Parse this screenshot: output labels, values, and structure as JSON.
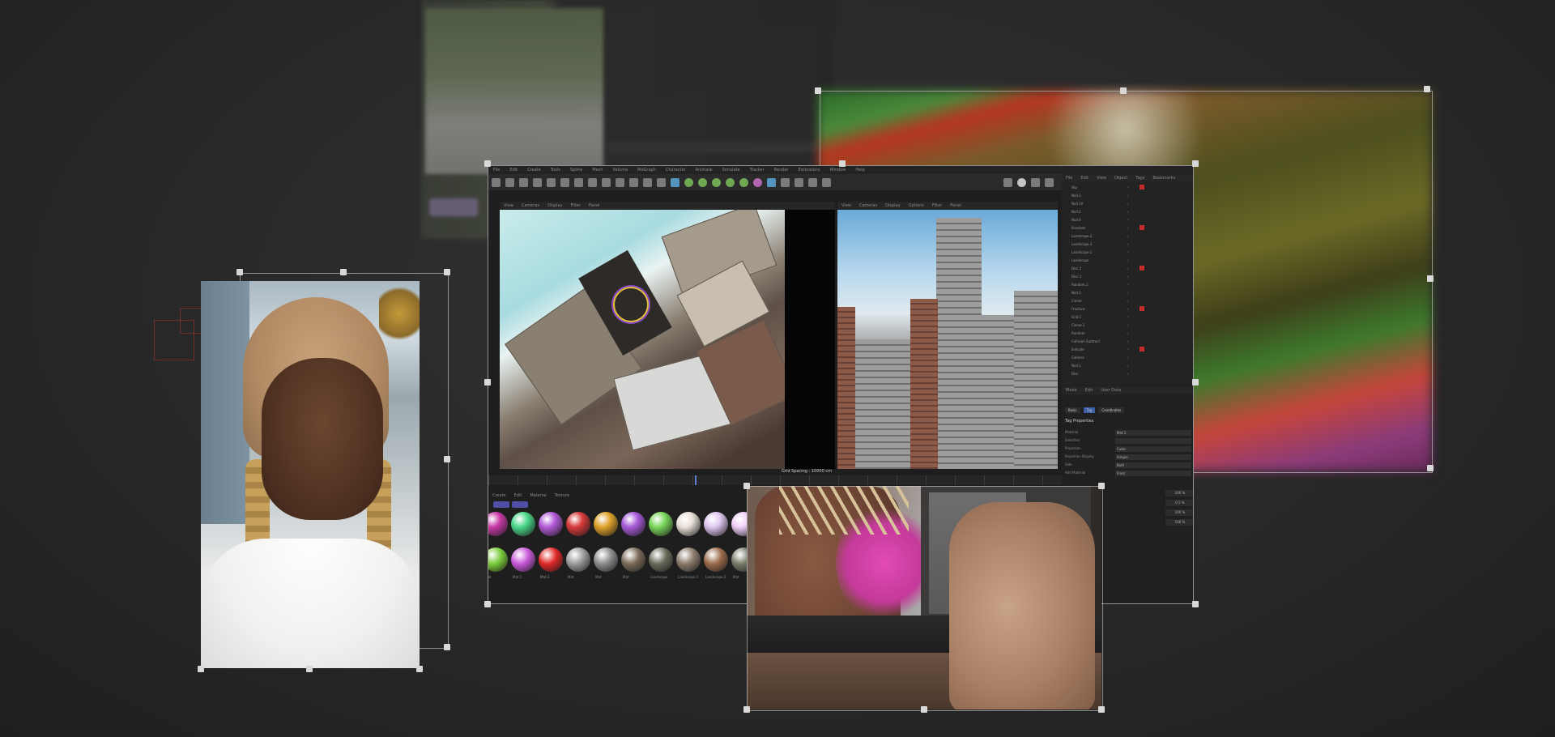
{
  "app": {
    "menu": [
      "File",
      "Edit",
      "Create",
      "Tools",
      "Spline",
      "Mesh",
      "Volume",
      "MoGraph",
      "Character",
      "Animate",
      "Simulate",
      "Tracker",
      "Render",
      "Extensions",
      "Window",
      "Help"
    ],
    "viewport_left_menu": [
      "View",
      "Cameras",
      "Display",
      "Filter",
      "Panel"
    ],
    "viewport_right_menu": [
      "View",
      "Cameras",
      "Display",
      "Options",
      "Filter",
      "Panel"
    ],
    "grid_spacing": "Grid Spacing : 10000 cm",
    "object_manager_menu": [
      "File",
      "Edit",
      "View",
      "Object",
      "Tags",
      "Bookmarks"
    ],
    "objects": [
      "Sky",
      "Null.3",
      "Null.10",
      "Null.2",
      "Null.6",
      "Brackets",
      "Landscape.2",
      "Landscape.3",
      "Landscape.1",
      "Landscape",
      "Disc.2",
      "Disc.1",
      "Random.1",
      "Null.3",
      "Cloner",
      "Fracture",
      "Grid.1",
      "Cloner.1",
      "Random",
      "Collision Subtract",
      "Extrude",
      "Camera",
      "Null.1",
      "Disc"
    ],
    "attributes_menu": [
      "Mode",
      "Edit",
      "User Data"
    ],
    "attributes_tabs": [
      "Basic",
      "Tag",
      "Coordinates"
    ],
    "attributes_title": "Tag Properties",
    "attributes_rows": [
      "Material",
      "Selection",
      "Projection",
      "Projection Display",
      "Side",
      "Add Material"
    ],
    "attributes_values": [
      "Mat.1",
      "",
      "Cubic",
      "Simple",
      "Both",
      "Front"
    ],
    "percent_values": [
      "100 %",
      "0.5 %",
      "100 %",
      "100 %"
    ],
    "materials_menu": [
      "Create",
      "Edit",
      "Material",
      "Texture"
    ],
    "materials_row2_labels": [
      "Mat",
      "Mat.1",
      "Mat.2",
      "Mat",
      "Mat",
      "Mat",
      "Landscape",
      "Landscape.1",
      "Landscape.2",
      "Mat",
      "Mat"
    ]
  },
  "colors": {
    "background": "#262626",
    "handle": "#d9d9d9",
    "accent_blue": "#5f7fd8",
    "check_green": "#59c259",
    "tag_red": "#c92a2a"
  }
}
